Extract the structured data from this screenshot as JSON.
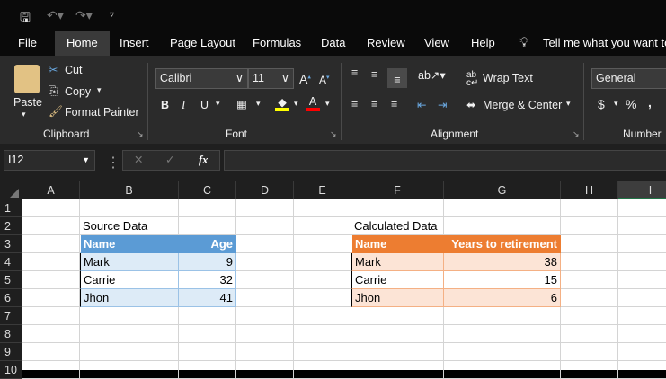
{
  "quick_access": {
    "save": "save-icon",
    "undo": "undo-icon",
    "redo": "redo-icon",
    "customize": "customize-icon"
  },
  "tabs": [
    "File",
    "Home",
    "Insert",
    "Page Layout",
    "Formulas",
    "Data",
    "Review",
    "View",
    "Help"
  ],
  "tell_me": "Tell me what you want to do",
  "ribbon": {
    "clipboard": {
      "paste": "Paste",
      "cut": "Cut",
      "copy": "Copy",
      "format_painter": "Format Painter",
      "label": "Clipboard"
    },
    "font": {
      "name": "Calibri",
      "size": "11",
      "bold": "B",
      "italic": "I",
      "underline": "U",
      "label": "Font"
    },
    "alignment": {
      "wrap_text": "Wrap Text",
      "merge_center": "Merge & Center",
      "label": "Alignment"
    },
    "number": {
      "format": "General",
      "currency": "$",
      "percent": "%",
      "comma": ",",
      "label": "Number"
    }
  },
  "formula_bar": {
    "name_box": "I12",
    "fx": "fx",
    "value": ""
  },
  "sheet": {
    "columns": [
      "A",
      "B",
      "C",
      "D",
      "E",
      "F",
      "G",
      "H",
      "I"
    ],
    "selected_column": "I",
    "rows": [
      "1",
      "2",
      "3",
      "4",
      "5",
      "6",
      "7",
      "8",
      "9",
      "10"
    ],
    "cells": [
      {
        "ref": "B2",
        "value": "Source Data"
      },
      {
        "ref": "F2",
        "value": "Calculated Data"
      },
      {
        "ref": "B3",
        "value": "Name"
      },
      {
        "ref": "C3",
        "value": "Age"
      },
      {
        "ref": "B4",
        "value": "Mark"
      },
      {
        "ref": "C4",
        "value": "9"
      },
      {
        "ref": "B5",
        "value": "Carrie"
      },
      {
        "ref": "C5",
        "value": "32"
      },
      {
        "ref": "B6",
        "value": "Jhon"
      },
      {
        "ref": "C6",
        "value": "41"
      },
      {
        "ref": "F3",
        "value": "Name"
      },
      {
        "ref": "G3",
        "value": "Years to retirement"
      },
      {
        "ref": "F4",
        "value": "Mark"
      },
      {
        "ref": "G4",
        "value": "38"
      },
      {
        "ref": "F5",
        "value": "Carrie"
      },
      {
        "ref": "G5",
        "value": "15"
      },
      {
        "ref": "F6",
        "value": "Jhon"
      },
      {
        "ref": "G6",
        "value": "6"
      }
    ]
  },
  "colors": {
    "blue_header": "#5b9bd5",
    "blue_band": "#ddebf7",
    "orange_header": "#ed7d31",
    "orange_band": "#fce4d6"
  }
}
